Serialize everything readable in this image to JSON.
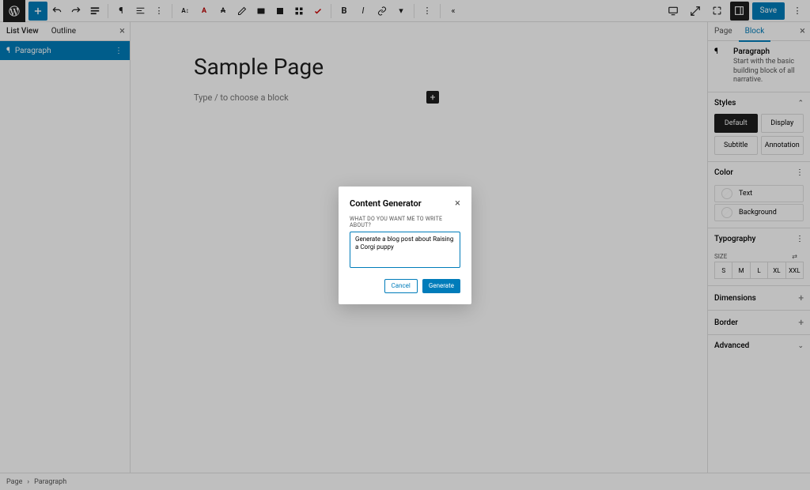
{
  "toolbar": {
    "save_label": "Save"
  },
  "left_panel": {
    "tabs": {
      "list_view": "List View",
      "outline": "Outline"
    },
    "item_label": "Paragraph"
  },
  "canvas": {
    "title": "Sample Page",
    "placeholder": "Type / to choose a block"
  },
  "right_panel": {
    "tabs": {
      "page": "Page",
      "block": "Block"
    },
    "block": {
      "title": "Paragraph",
      "description": "Start with the basic building block of all narrative."
    },
    "sections": {
      "styles": {
        "label": "Styles",
        "options": [
          "Default",
          "Display",
          "Subtitle",
          "Annotation"
        ]
      },
      "color": {
        "label": "Color",
        "text": "Text",
        "background": "Background"
      },
      "typography": {
        "label": "Typography",
        "size_label": "SIZE",
        "sizes": [
          "S",
          "M",
          "L",
          "XL",
          "XXL"
        ]
      },
      "dimensions": {
        "label": "Dimensions"
      },
      "border": {
        "label": "Border"
      },
      "advanced": {
        "label": "Advanced"
      }
    }
  },
  "footer": {
    "crumbs": [
      "Page",
      "Paragraph"
    ]
  },
  "modal": {
    "title": "Content Generator",
    "label": "WHAT DO YOU WANT ME TO WRITE ABOUT?",
    "value": "Generate a blog post about Raising a Corgi puppy",
    "cancel": "Cancel",
    "generate": "Generate"
  }
}
